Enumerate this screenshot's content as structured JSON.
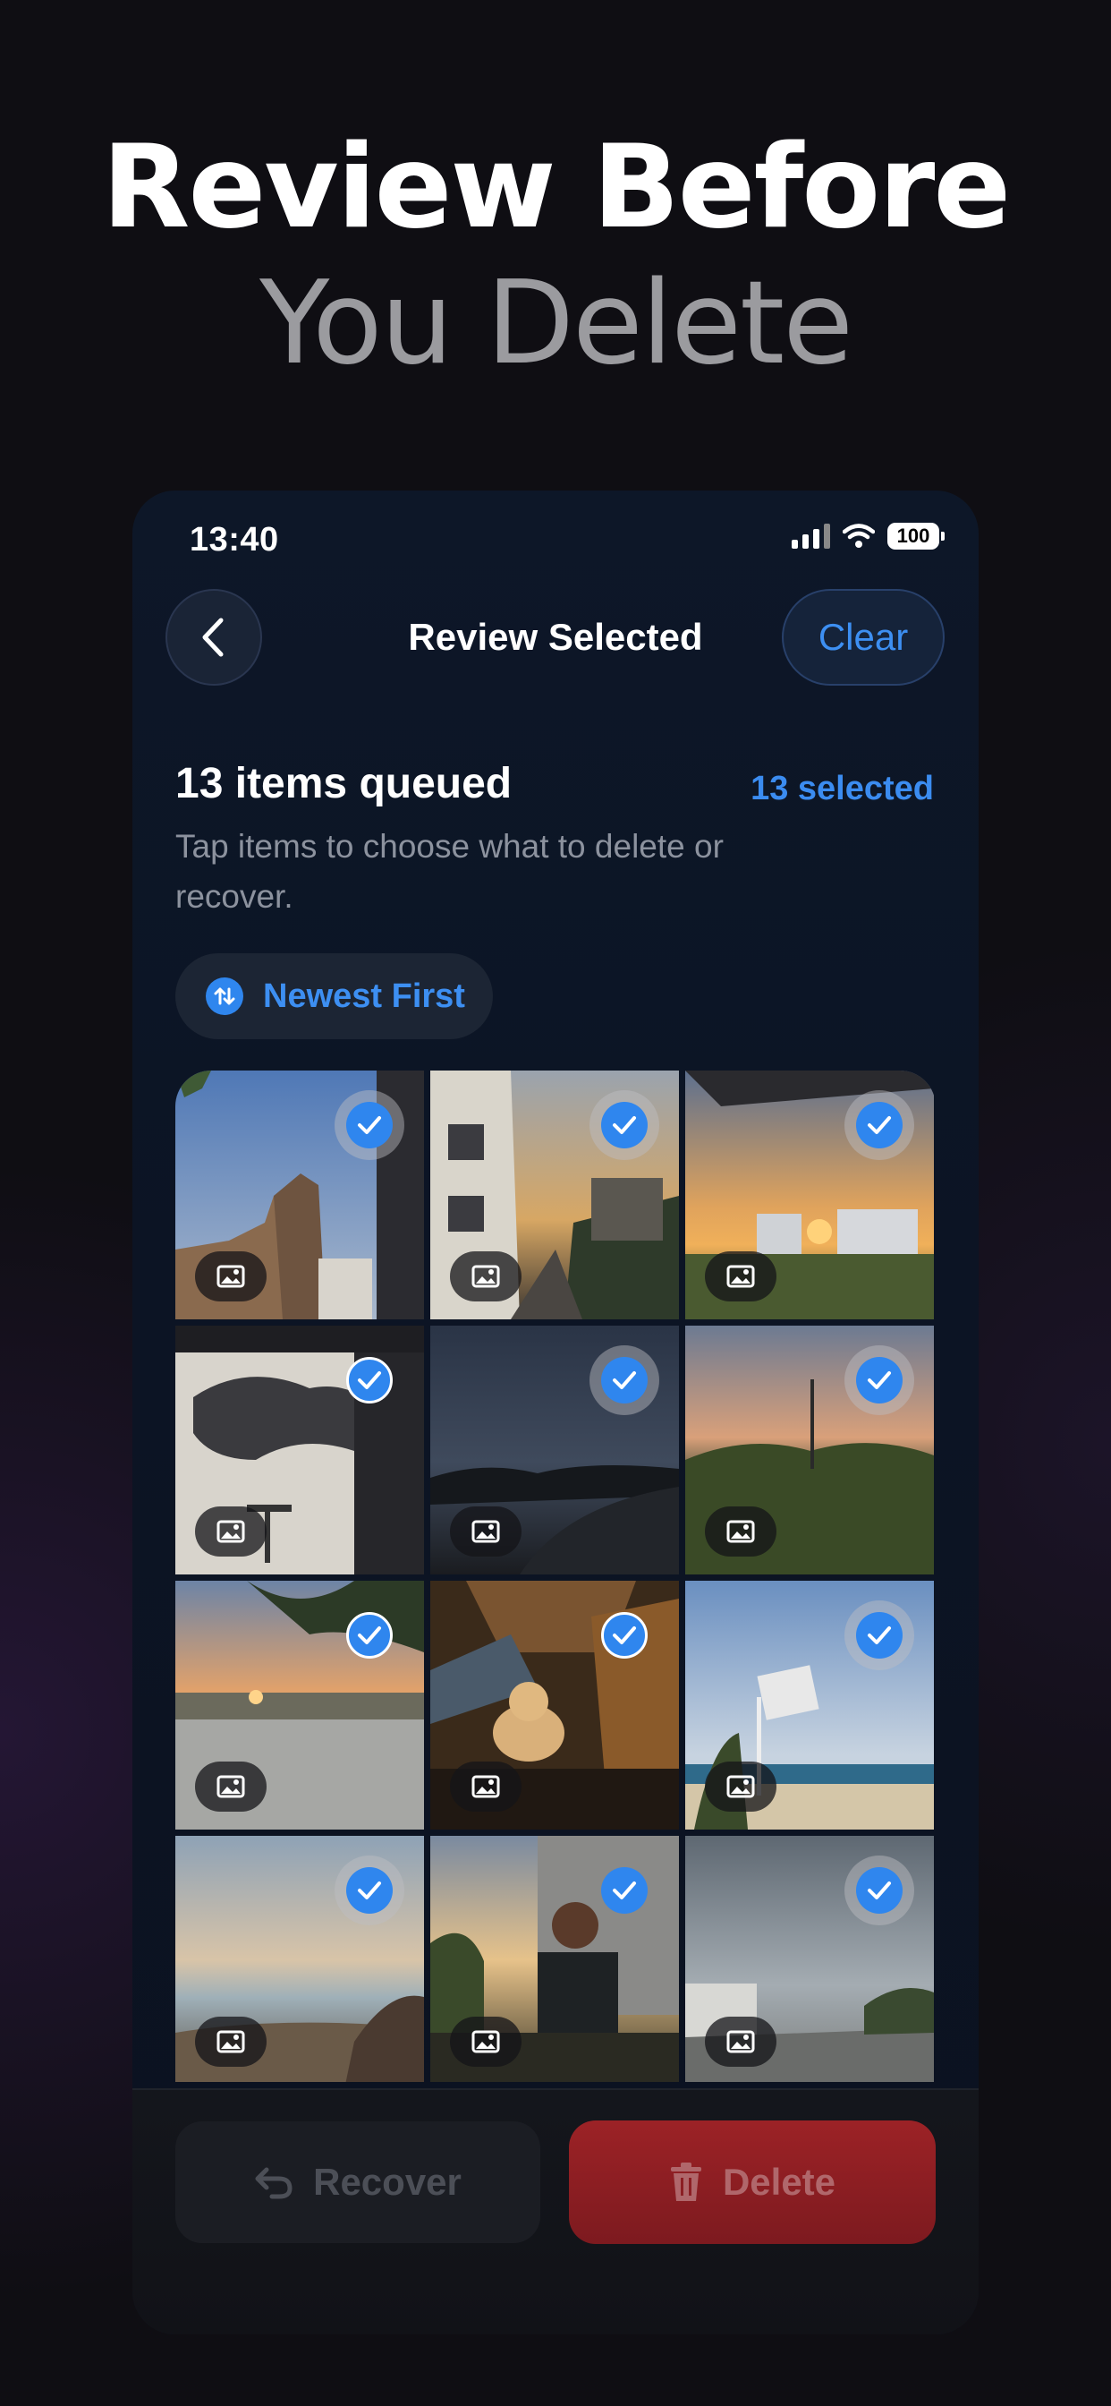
{
  "hero": {
    "line1": "Review Before",
    "line2": "You Delete"
  },
  "status_bar": {
    "time": "13:40",
    "battery": "100"
  },
  "nav": {
    "back_icon": "chevron-left-icon",
    "title": "Review Selected",
    "clear_label": "Clear"
  },
  "summary": {
    "queued": "13 items queued",
    "selected": "13 selected",
    "instructions": "Tap items to choose what to delete or recover."
  },
  "sort": {
    "icon": "sort-arrows-icon",
    "label": "Newest First"
  },
  "grid": {
    "item_icon": "photo-icon",
    "check_icon": "checkmark-icon",
    "items": [
      {
        "scene": "ruins-sky",
        "selected": true
      },
      {
        "scene": "street-sunset",
        "selected": true
      },
      {
        "scene": "city-sunset",
        "selected": true
      },
      {
        "scene": "cloudy-interior",
        "selected": true
      },
      {
        "scene": "dusk-road",
        "selected": true
      },
      {
        "scene": "field-dusk",
        "selected": true
      },
      {
        "scene": "palm-river",
        "selected": true
      },
      {
        "scene": "cat-night",
        "selected": true
      },
      {
        "scene": "beach-hoop",
        "selected": true
      },
      {
        "scene": "shore-calm",
        "selected": true
      },
      {
        "scene": "man-tower",
        "selected": true
      },
      {
        "scene": "overcast-street",
        "selected": true
      }
    ]
  },
  "actions": {
    "recover_label": "Recover",
    "recover_icon": "undo-arrow-icon",
    "delete_label": "Delete",
    "delete_icon": "trash-icon"
  },
  "colors": {
    "accent": "#2f86ee",
    "delete": "#8c1e23",
    "background": "#0f0e13",
    "card": "#0c1424"
  }
}
